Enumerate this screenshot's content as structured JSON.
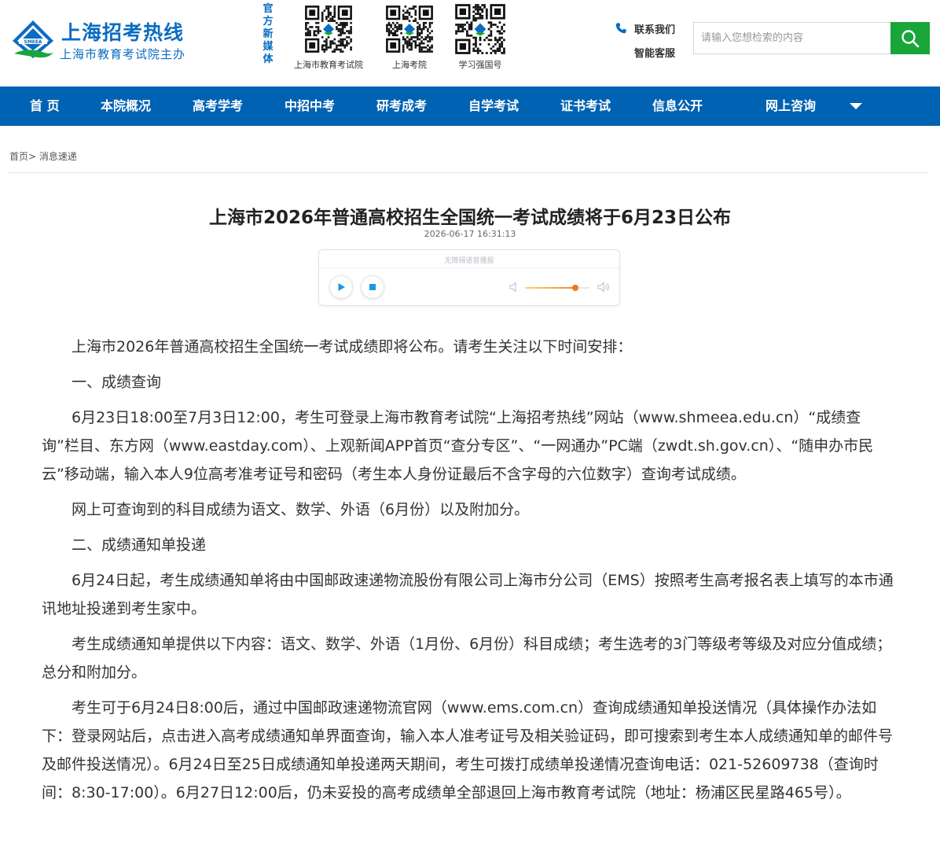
{
  "header": {
    "site_name": "上海招考热线",
    "site_sub": "上海市教育考试院主办",
    "media_label": [
      "官",
      "方",
      "新",
      "媒",
      "体"
    ],
    "qrcodes": [
      {
        "caption": "上海市教育考试院"
      },
      {
        "caption": "上海考院"
      },
      {
        "caption": "学习强国号"
      }
    ],
    "contact": {
      "contact_us": "联系我们",
      "service": "智能客服"
    },
    "search": {
      "placeholder": "请输入您想检索的内容"
    }
  },
  "nav": {
    "items": [
      "首 页",
      "本院概况",
      "高考学考",
      "中招中考",
      "研考成考",
      "自学考试",
      "证书考试",
      "信息公开",
      "网上咨询"
    ]
  },
  "breadcrumb": {
    "home": "首页",
    "sep": ">",
    "current": "消息速递"
  },
  "article": {
    "title": "上海市2026年普通高校招生全国统一考试成绩将于6月23日公布",
    "date": "2026-06-17 16:31:13",
    "paragraphs": [
      "上海市2026年普通高校招生全国统一考试成绩即将公布。请考生关注以下时间安排：",
      "一、成绩查询",
      "6月23日18:00至7月3日12:00，考生可登录上海市教育考试院“上海招考热线”网站（www.shmeea.edu.cn）“成绩查询”栏目、东方网（www.eastday.com）、上观新闻APP首页“查分专区”、“一网通办”PC端（zwdt.sh.gov.cn）、“随申办市民云”移动端，输入本人9位高考准考证号和密码（考生本人身份证最后不含字母的六位数字）查询考试成绩。",
      "网上可查询到的科目成绩为语文、数学、外语（6月份）以及附加分。",
      "二、成绩通知单投递",
      "6月24日起，考生成绩通知单将由中国邮政速递物流股份有限公司上海市分公司（EMS）按照考生高考报名表上填写的本市通讯地址投递到考生家中。",
      "考生成绩通知单提供以下内容：语文、数学、外语（1月份、6月份）科目成绩；考生选考的3门等级考等级及对应分值成绩；总分和附加分。",
      "考生可于6月24日8:00后，通过中国邮政速递物流官网（www.ems.com.cn）查询成绩通知单投送情况（具体操作办法如下：登录网站后，点击进入高考成绩通知单界面查询，输入本人准考证号及相关验证码，即可搜索到考生本人成绩通知单的邮件号及邮件投送情况）。6月24日至25日成绩通知单投递两天期间，考生可拨打成绩单投递情况查询电话：021-52609738（查询时间：8:30-17:00）。6月27日12:00后，仍未妥投的高考成绩单全部退回上海市教育考试院（地址：杨浦区民星路465号）。"
    ]
  },
  "player": {
    "label": "无障碍语音播报",
    "volume": 0.78
  },
  "colors": {
    "brand_blue": "#0062b3",
    "logo_blue": "#0a6cc2",
    "search_green": "#1aa53a",
    "volume_orange": "#f07a12"
  },
  "icons": [
    "logo-mark-icon",
    "qr-code-icon",
    "phone-icon",
    "search-icon",
    "caret-down-icon",
    "play-icon",
    "stop-icon",
    "volume-low-icon",
    "volume-high-icon"
  ]
}
